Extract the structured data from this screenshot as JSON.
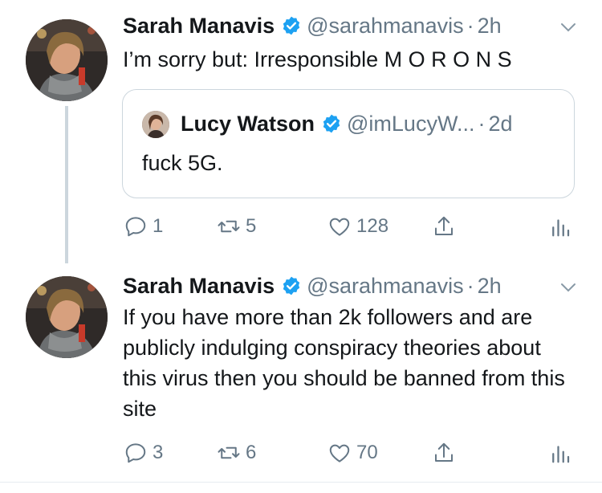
{
  "tweets": [
    {
      "author_name": "Sarah Manavis",
      "handle": "@sarahmanavis",
      "separator": "·",
      "time": "2h",
      "text": "I’m sorry but: Irresponsible M O R O N S",
      "quote": {
        "author_name": "Lucy Watson",
        "handle": "@imLucyW...",
        "separator": "·",
        "time": "2d",
        "text": "fuck 5G."
      },
      "actions": {
        "replies": "1",
        "retweets": "5",
        "likes": "128"
      }
    },
    {
      "author_name": "Sarah Manavis",
      "handle": "@sarahmanavis",
      "separator": "·",
      "time": "2h",
      "text": "If you have more than 2k followers and are publicly indulging conspiracy theories about this virus then you should be banned from this site",
      "actions": {
        "replies": "3",
        "retweets": "6",
        "likes": "70"
      }
    }
  ],
  "icons": {
    "verified": "verified-badge-icon",
    "caret": "chevron-down-icon",
    "reply": "reply-icon",
    "retweet": "retweet-icon",
    "like": "heart-icon",
    "share": "share-icon",
    "analytics": "analytics-icon"
  },
  "colors": {
    "verified": "#1da1f2",
    "secondary_text": "#657786",
    "border": "#ccd6dd",
    "primary_text": "#14171a"
  }
}
